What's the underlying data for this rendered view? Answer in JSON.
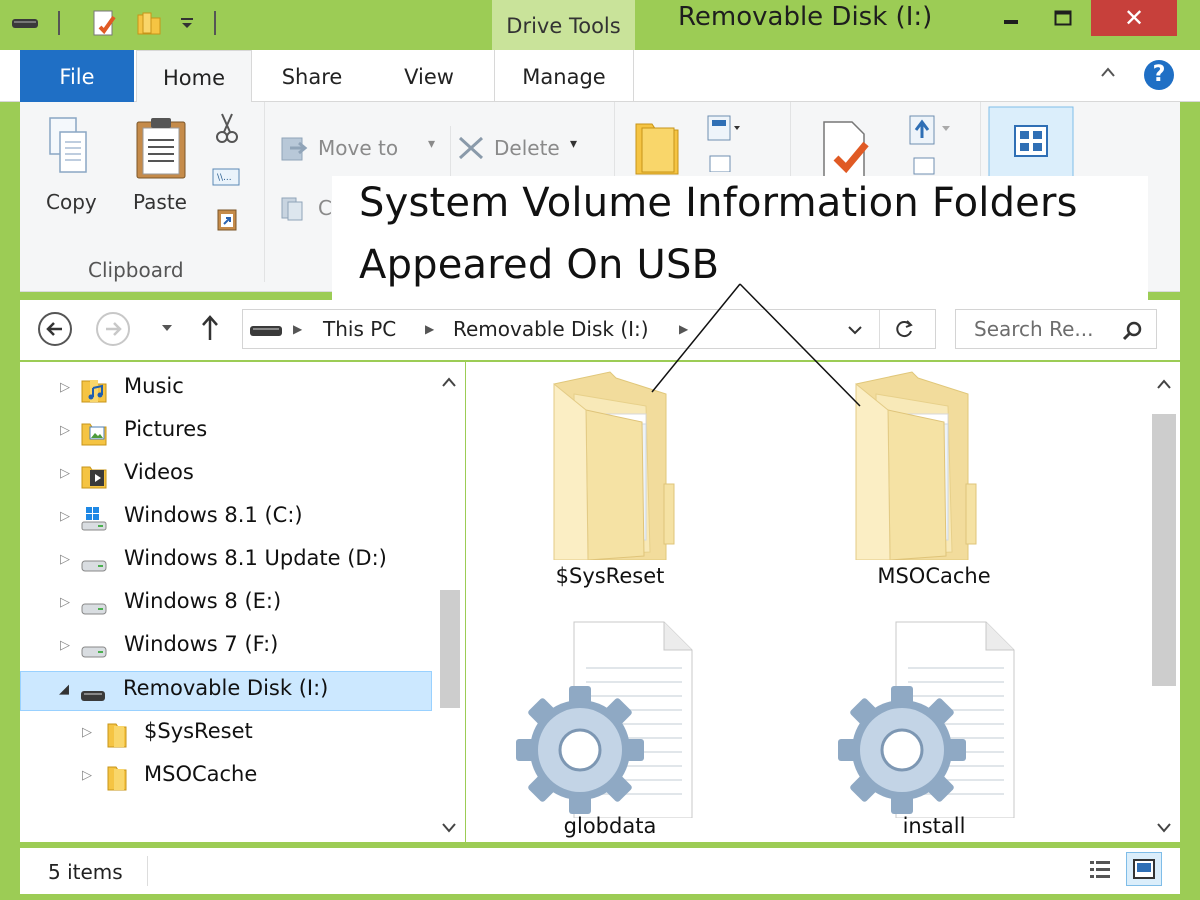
{
  "window": {
    "title": "Removable Disk (I:)",
    "context_tab": "Drive Tools",
    "close_glyph": "✕"
  },
  "tabs": {
    "file": "File",
    "home": "Home",
    "share": "Share",
    "view": "View",
    "manage": "Manage"
  },
  "ribbon": {
    "copy": "Copy",
    "paste": "Paste",
    "clipboard_group": "Clipboard",
    "move_to": "Move to",
    "delete": "Delete",
    "copy_to_partial": "C"
  },
  "annotation": {
    "line1": "System Volume Information Folders",
    "line2": "Appeared On USB"
  },
  "address": {
    "crumbs": [
      "This PC",
      "Removable Disk (I:)"
    ],
    "search_placeholder": "Search Re..."
  },
  "nav_tree": [
    {
      "label": "Music",
      "icon": "music-folder-icon"
    },
    {
      "label": "Pictures",
      "icon": "pictures-folder-icon"
    },
    {
      "label": "Videos",
      "icon": "videos-folder-icon"
    },
    {
      "label": "Windows 8.1 (C:)",
      "icon": "windows-drive-icon"
    },
    {
      "label": "Windows 8.1 Update (D:)",
      "icon": "drive-icon"
    },
    {
      "label": "Windows 8 (E:)",
      "icon": "drive-icon"
    },
    {
      "label": "Windows 7 (F:)",
      "icon": "drive-icon"
    },
    {
      "label": "Removable Disk (I:)",
      "icon": "usb-drive-icon",
      "selected": true
    },
    {
      "label": "$SysReset",
      "icon": "folder-icon"
    },
    {
      "label": "MSOCache",
      "icon": "folder-icon"
    }
  ],
  "files": [
    {
      "name": "$SysReset",
      "type": "folder"
    },
    {
      "name": "MSOCache",
      "type": "folder"
    },
    {
      "name": "globdata",
      "type": "settings-file"
    },
    {
      "name": "install",
      "type": "settings-file"
    }
  ],
  "status": {
    "item_count": "5 items"
  },
  "colors": {
    "frame": "#9ccc55",
    "file_tab": "#1f6fc5",
    "close_button": "#c7403b",
    "selection": "#cce8ff"
  }
}
